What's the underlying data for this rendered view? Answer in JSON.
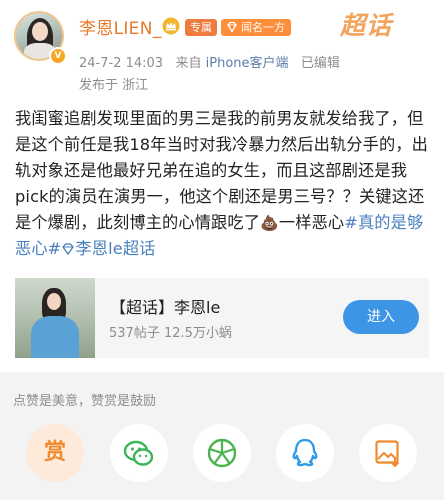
{
  "user": {
    "name": "李恩LIEN_",
    "tag_zhuanshu": "专属",
    "tag_wenming": "闻名一方"
  },
  "brand": {
    "logo_text": "超话"
  },
  "meta": {
    "date_time": "24-7-2 14:03",
    "source_prefix": "来自",
    "source_device": "iPhone客户端",
    "edited": "已编辑",
    "location": "发布于 浙江"
  },
  "post": {
    "text": "我闺蜜追剧发现里面的男三是我的前男友就发给我了，但是这个前任是我18年当时对我冷暴力然后出轨分手的，出轨对象还是他最好兄弟在追的女生，而且这部剧还是我pick的演员在演男一，他这个剧还是男三号？？关键这还是个爆剧，此刻博主的心情跟吃了",
    "emoji": "💩",
    "text_after_emoji": "一样恶心",
    "hashtag1": "#真的是够恶心#",
    "hashtag2": "李恩le超话"
  },
  "topic_card": {
    "title": "【超话】李恩le",
    "stats": "537帖子 12.5万小蜗",
    "button_label": "进入"
  },
  "footer": {
    "donate_note": "点赞是美意，赞赏是鼓励",
    "reward_label": "赏"
  },
  "share_icons": [
    "reward-icon",
    "wechat-icon",
    "moments-icon",
    "qq-icon",
    "save-image-icon"
  ],
  "colors": {
    "username": "#e8782a",
    "link": "#4a7fbe",
    "button": "#3d95e6",
    "brand": "#f4a35c"
  }
}
